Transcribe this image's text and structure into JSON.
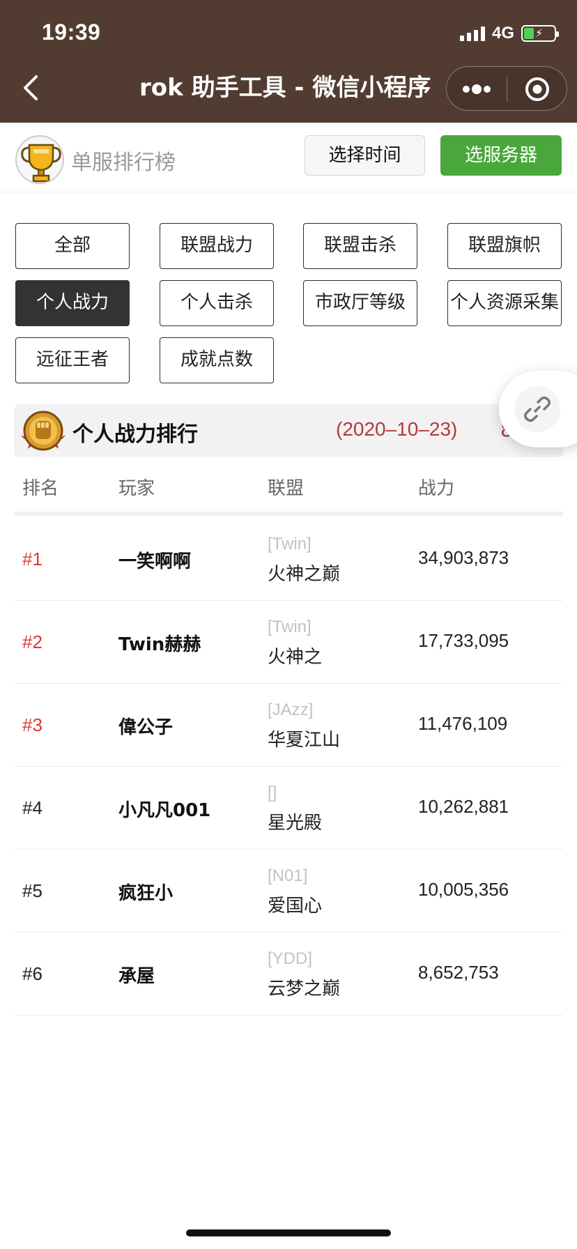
{
  "status_bar": {
    "time": "19:39",
    "network": "4G"
  },
  "nav": {
    "title": "rok 助手工具 - 微信小程序"
  },
  "filter_bar": {
    "board_name": "单服排行榜",
    "select_time_label": "选择时间",
    "select_server_label": "选服务器",
    "accent": "#49a73b"
  },
  "categories": [
    {
      "label": "全部",
      "active": false
    },
    {
      "label": "联盟战力",
      "active": false
    },
    {
      "label": "联盟击杀",
      "active": false
    },
    {
      "label": "联盟旗帜",
      "active": false
    },
    {
      "label": "个人战力",
      "active": true
    },
    {
      "label": "个人击杀",
      "active": false
    },
    {
      "label": "市政厅等级",
      "active": false
    },
    {
      "label": "个人资源采集",
      "active": false
    },
    {
      "label": "远征王者",
      "active": false
    },
    {
      "label": "成就点数",
      "active": false
    }
  ],
  "ranking": {
    "title": "个人战力排行",
    "date": "(2020–10–23)",
    "extra": "8",
    "columns": [
      "排名",
      "玩家",
      "联盟",
      "战力"
    ],
    "rows": [
      {
        "rank": "#1",
        "player": "一笑啊啊",
        "tag": "[Twin]",
        "alliance": "火神之巅",
        "power": "34,903,873",
        "top": true
      },
      {
        "rank": "#2",
        "player": "Twin赫赫",
        "tag": "[Twin]",
        "alliance": "火神之",
        "power": "17,733,095",
        "top": true
      },
      {
        "rank": "#3",
        "player": "偉公子",
        "tag": "[JAzz]",
        "alliance": "华夏江山",
        "power": "11,476,109",
        "top": true
      },
      {
        "rank": "#4",
        "player": "小凡凡001",
        "tag": "[]",
        "alliance": "星光殿",
        "power": "10,262,881",
        "top": false
      },
      {
        "rank": "#5",
        "player": "疯狂小",
        "tag": "[N01]",
        "alliance": "爱国心",
        "power": "10,005,356",
        "top": false
      },
      {
        "rank": "#6",
        "player": "承屋",
        "tag": "[YDD]",
        "alliance": "云梦之巅",
        "power": "8,652,753",
        "top": false
      }
    ]
  },
  "colors": {
    "header_bg": "#523c31",
    "top_rank": "#d93a3a",
    "date": "#b33a3a"
  }
}
